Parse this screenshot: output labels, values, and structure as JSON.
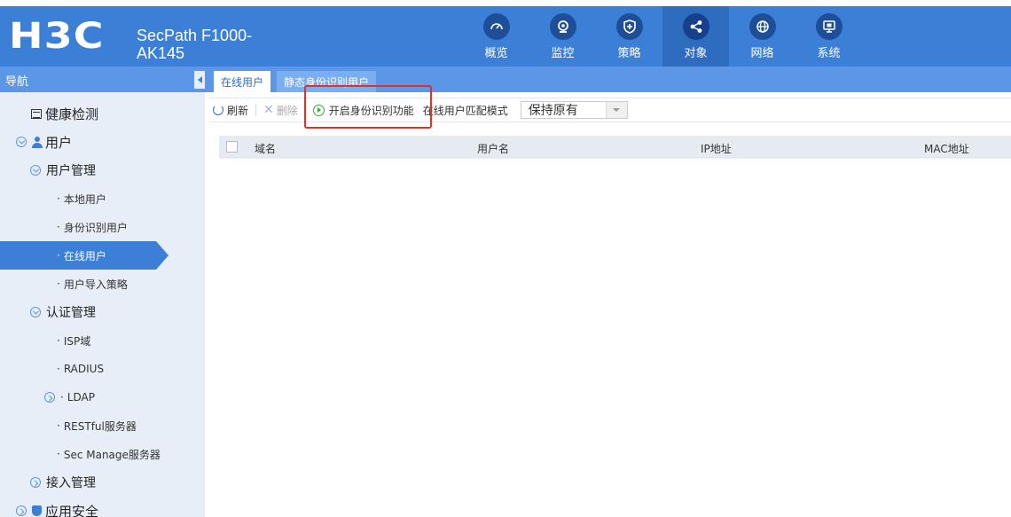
{
  "header": {
    "logo": "H3C",
    "product_line1": "SecPath F1000-",
    "product_line2": "AK145",
    "tabs": [
      {
        "label": "概览",
        "icon": "dashboard-icon",
        "active": false
      },
      {
        "label": "监控",
        "icon": "monitor-icon",
        "active": false
      },
      {
        "label": "策略",
        "icon": "shield-plus-icon",
        "active": false
      },
      {
        "label": "对象",
        "icon": "share-icon",
        "active": true
      },
      {
        "label": "网络",
        "icon": "globe-icon",
        "active": false
      },
      {
        "label": "系统",
        "icon": "system-icon",
        "active": false
      }
    ]
  },
  "subbar": {
    "nav_title": "导航",
    "content_tabs": [
      "在线用户",
      "静态身份识别用户"
    ]
  },
  "sidebar": {
    "health_check": "健康检测",
    "user": "用户",
    "user_management": "用户管理",
    "local_user": "本地用户",
    "identity_user": "身份识别用户",
    "online_user": "在线用户",
    "user_import_policy": "用户导入策略",
    "auth_management": "认证管理",
    "isp_domain": "ISP域",
    "radius": "RADIUS",
    "ldap": "LDAP",
    "restful_server": "RESTful服务器",
    "sec_manage_server": "Sec Manage服务器",
    "access_management": "接入管理",
    "app_security": "应用安全"
  },
  "toolbar": {
    "refresh": "刷新",
    "delete": "删除",
    "enable_identity": "开启身份识别功能",
    "match_mode_label": "在线用户匹配模式",
    "match_mode_value": "保持原有"
  },
  "table": {
    "columns": [
      "域名",
      "用户名",
      "IP地址",
      "MAC地址"
    ]
  },
  "colors": {
    "header_bg": "#3b7fd6",
    "active_tab": "#2e6cc0",
    "highlight": "#e0302a"
  }
}
